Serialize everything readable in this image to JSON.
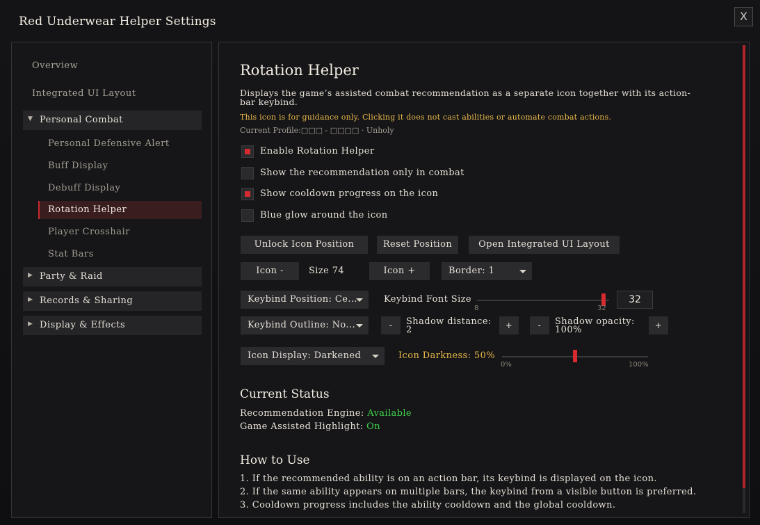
{
  "window": {
    "title": "Red Underwear Helper Settings",
    "close_label": "X"
  },
  "sidebar": {
    "top_items": [
      "Overview",
      "Integrated UI Layout"
    ],
    "categories": [
      {
        "label": "Personal Combat",
        "expanded": true
      },
      {
        "label": "Party & Raid",
        "expanded": false
      },
      {
        "label": "Records & Sharing",
        "expanded": false
      },
      {
        "label": "Display & Effects",
        "expanded": false
      }
    ],
    "sub_items": [
      "Personal Defensive Alert",
      "Buff Display",
      "Debuff Display",
      "Rotation Helper",
      "Player Crosshair",
      "Stat Bars"
    ],
    "selected_item": "Rotation Helper",
    "arrow_expanded": "▼",
    "arrow_collapsed": "▶"
  },
  "main": {
    "heading": "Rotation Helper",
    "description": "Displays the game’s assisted combat recommendation as a separate icon together with its action-bar keybind.",
    "warning": "This icon is for guidance only. Clicking it does not cast abilities or automate combat actions.",
    "profile": "Current Profile:□□□ - □□□□ · Unholy",
    "checkboxes": [
      {
        "label": "Enable Rotation Helper",
        "checked": true
      },
      {
        "label": "Show the recommendation only in combat",
        "checked": false
      },
      {
        "label": "Show cooldown progress on the icon",
        "checked": true
      },
      {
        "label": "Blue glow around the icon",
        "checked": false
      }
    ],
    "buttons": {
      "unlock": "Unlock Icon Position",
      "reset": "Reset Position",
      "open_layout": "Open Integrated UI Layout",
      "icon_minus": "Icon -",
      "icon_plus": "Icon +",
      "minus": "-",
      "plus": "+"
    },
    "size_label": "Size 74",
    "border_dropdown": "Border: 1",
    "keybind_position_dropdown": "Keybind Position: Ce...",
    "keybind_font_size": {
      "label": "Keybind Font Size",
      "value": "32",
      "min": "8",
      "max": "32",
      "fraction": 1.0
    },
    "keybind_outline_dropdown": "Keybind Outline: No...",
    "shadow_distance": {
      "label": "Shadow distance:",
      "value": "2"
    },
    "shadow_opacity": {
      "label": "Shadow opacity:",
      "value": "100%"
    },
    "icon_display_dropdown": "Icon Display: Darkened",
    "icon_darkness": {
      "label": "Icon Darkness: 50%",
      "min": "0%",
      "max": "100%",
      "fraction": 0.5
    },
    "status": {
      "heading": "Current Status",
      "engine_label": "Recommendation Engine:",
      "engine_value": "Available",
      "highlight_label": "Game Assisted Highlight:",
      "highlight_value": "On"
    },
    "howto": {
      "heading": "How to Use",
      "lines": [
        "1. If the recommended ability is on an action bar, its keybind is displayed on the icon.",
        "2. If the same ability appears on multiple bars, the keybind from a visible button is preferred.",
        "3. Cooldown progress includes the ability cooldown and the global cooldown."
      ]
    }
  },
  "colors": {
    "accent": "#d42a30",
    "gold": "#e8b84a",
    "status_green": "#3fd24a",
    "panel": "#161618",
    "control": "#2b2b2e"
  }
}
